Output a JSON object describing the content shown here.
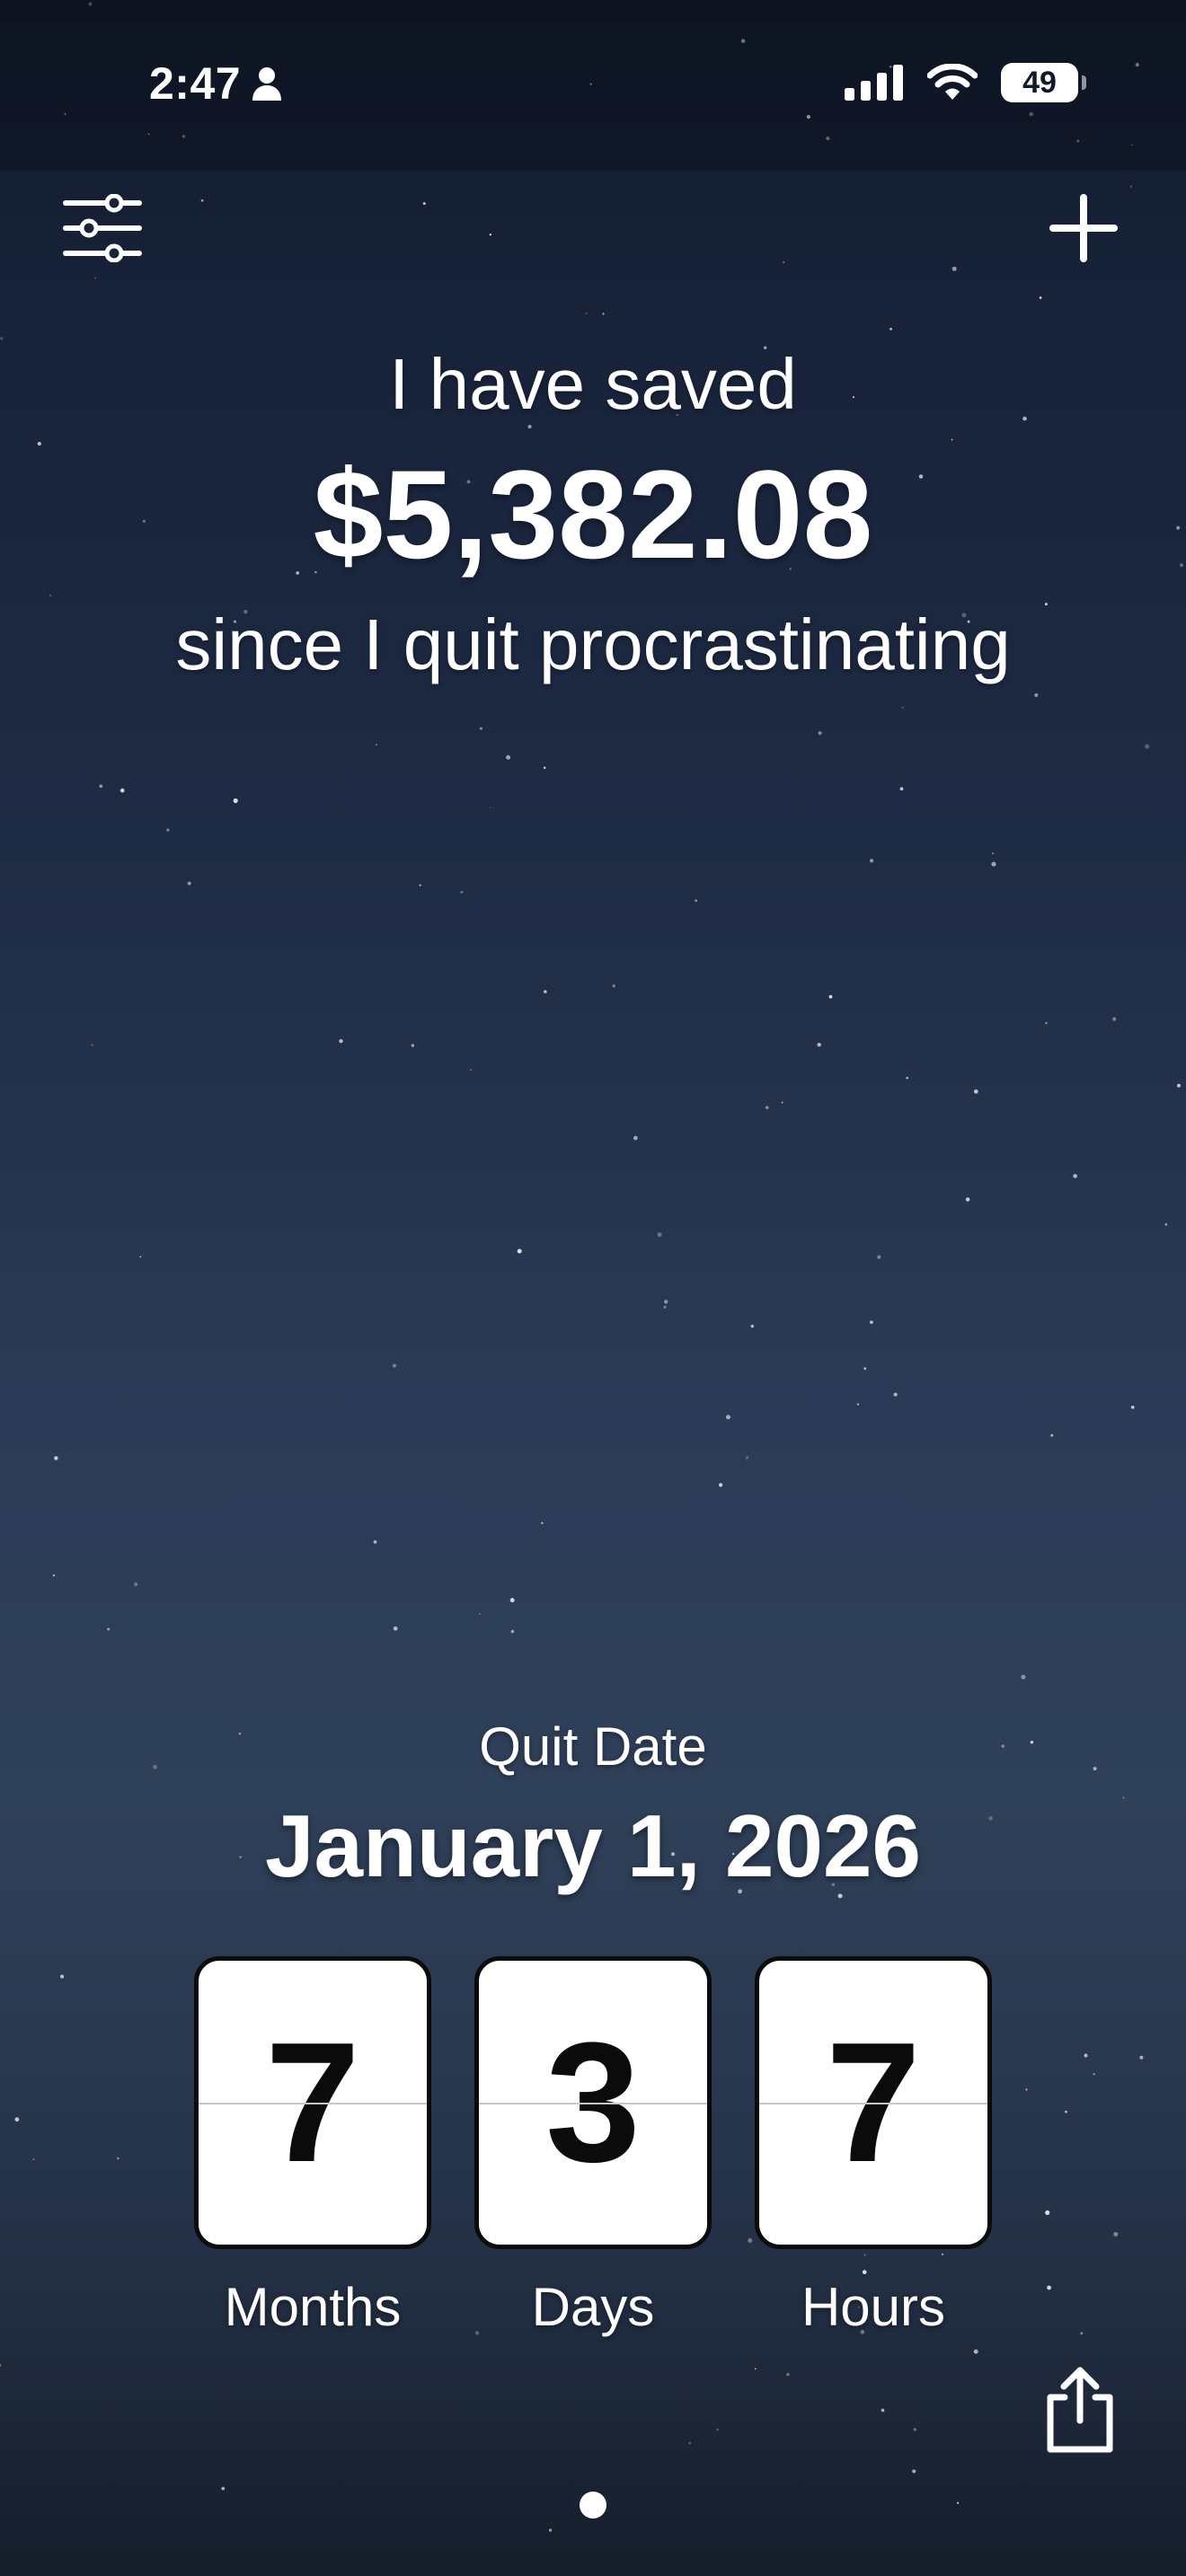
{
  "status_bar": {
    "time": "2:47",
    "battery": "49",
    "icons": [
      "person-icon",
      "signal-icon",
      "wifi-icon",
      "battery-icon"
    ]
  },
  "toolbar": {
    "settings_icon": "sliders-icon",
    "add_icon": "plus-icon"
  },
  "savings": {
    "prefix": "I have saved",
    "amount": "$5,382.08",
    "suffix": "since I quit procrastinating"
  },
  "quit": {
    "label": "Quit Date",
    "date": "January 1, 2026"
  },
  "counters": [
    {
      "value": "7",
      "label": "Months"
    },
    {
      "value": "3",
      "label": "Days"
    },
    {
      "value": "7",
      "label": "Hours"
    }
  ],
  "footer": {
    "share_icon": "share-icon",
    "page_indicator": {
      "current": 1,
      "total": 1
    }
  },
  "colors": {
    "text": "#ffffff",
    "card": "#ffffff",
    "card_digit": "#0b0b0b"
  }
}
